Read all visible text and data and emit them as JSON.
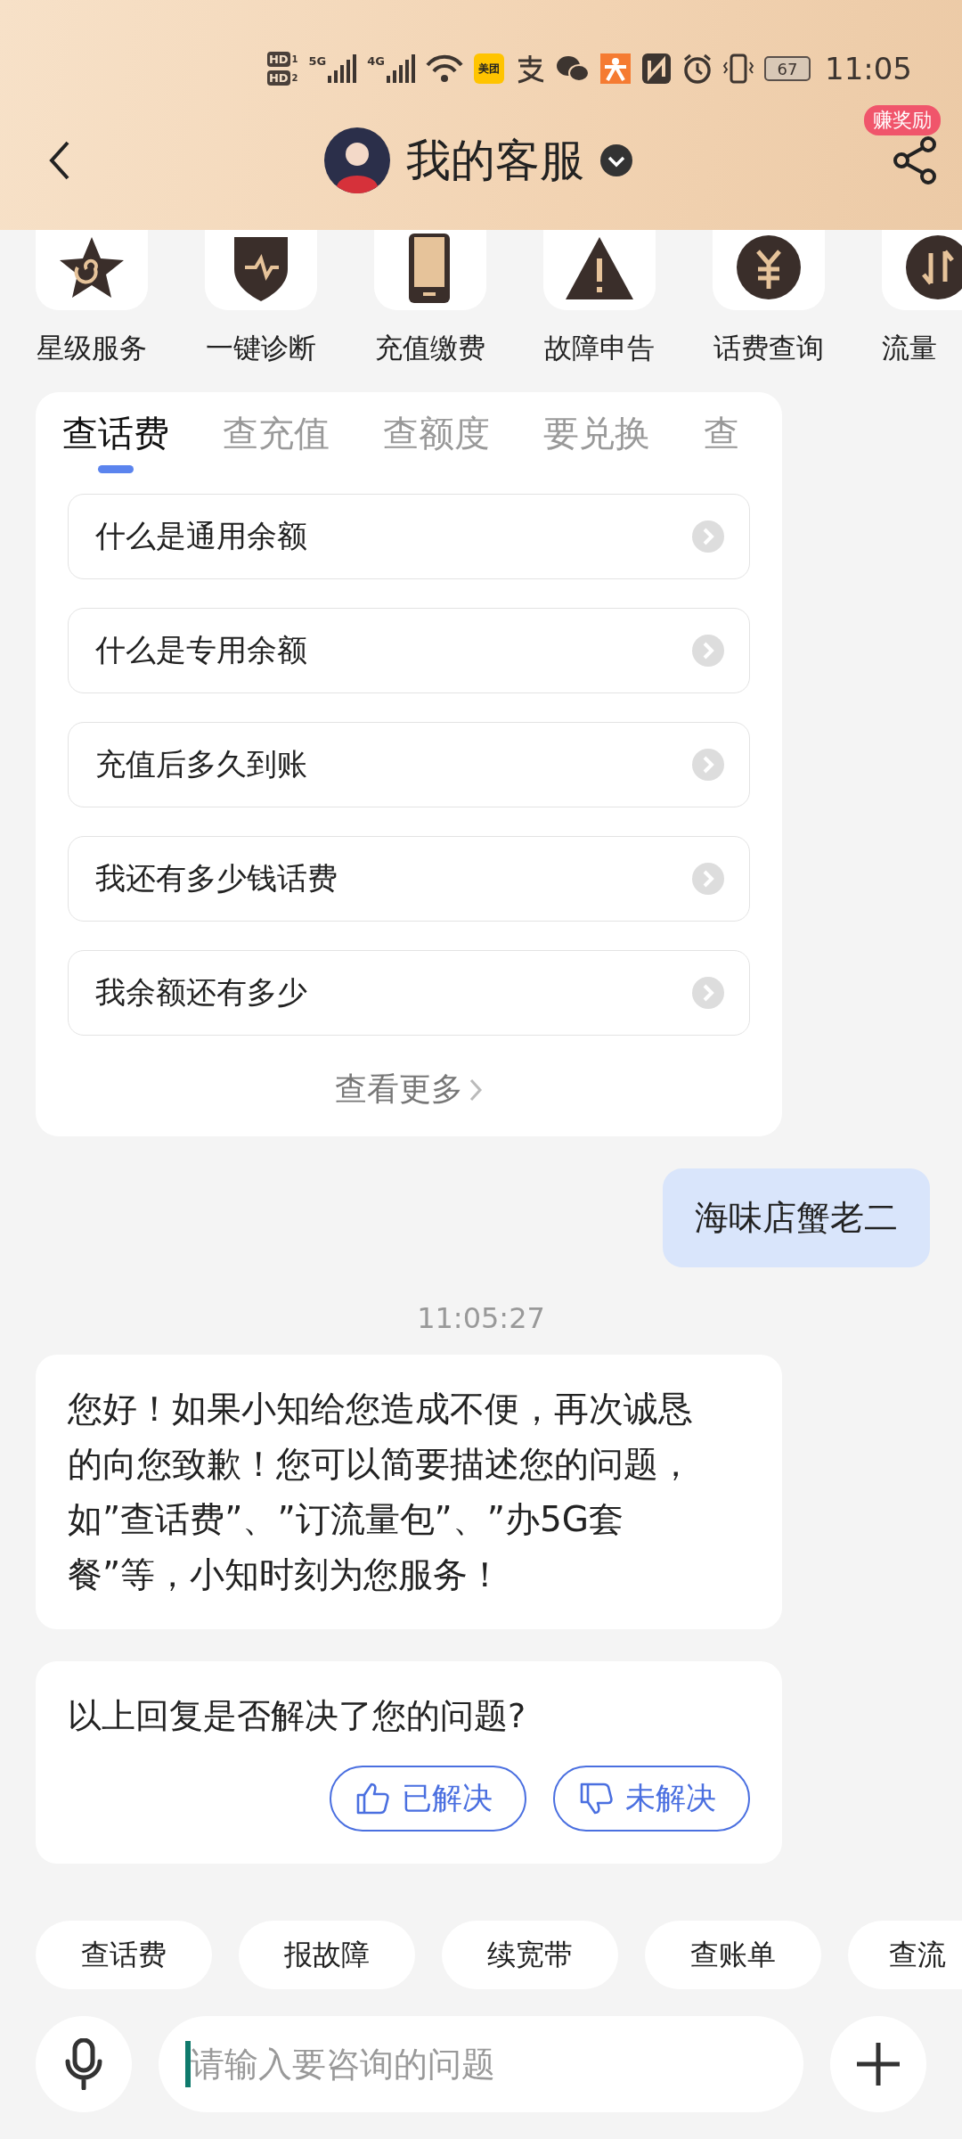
{
  "status_bar": {
    "sim_labels": [
      {
        "label": "HD",
        "slot": "1"
      },
      {
        "label": "HD",
        "slot": "2"
      }
    ],
    "networks": [
      "5G",
      "4G"
    ],
    "app_badge": "美团",
    "time": "11:05",
    "battery": "67"
  },
  "header": {
    "title": "我的客服",
    "badge": "赚奖励"
  },
  "shortcuts": [
    "星级服务",
    "一键诊断",
    "充值缴费",
    "故障申告",
    "话费查询",
    "流量"
  ],
  "faq": {
    "tabs": [
      {
        "label": "查话费",
        "selected": true
      },
      {
        "label": "查充值",
        "selected": false
      },
      {
        "label": "查额度",
        "selected": false
      },
      {
        "label": "要兑换",
        "selected": false
      },
      {
        "label": "查",
        "selected": false
      }
    ],
    "questions": [
      "什么是通用余额",
      "什么是专用余额",
      "充值后多久到账",
      "我还有多少钱话费",
      "我余额还有多少"
    ],
    "more": "查看更多"
  },
  "messages": [
    {
      "kind": "user",
      "text": "海味店蟹老二"
    },
    {
      "kind": "time",
      "text": "11:05:27"
    },
    {
      "kind": "bot",
      "text": "您好！如果小知给您造成不便，再次诚恳的向您致歉！您可以简要描述您的问题，如”查话费”、”订流量包”、”办5G套餐”等，小知时刻为您服务！"
    },
    {
      "kind": "feedback",
      "text": "以上回复是否解决了您的问题?",
      "buttons": [
        "已解决",
        "未解决"
      ]
    }
  ],
  "quick_replies": [
    "查话费",
    "报故障",
    "续宽带",
    "查账单",
    "查流"
  ],
  "input": {
    "placeholder": "请输入要咨询的问题"
  }
}
